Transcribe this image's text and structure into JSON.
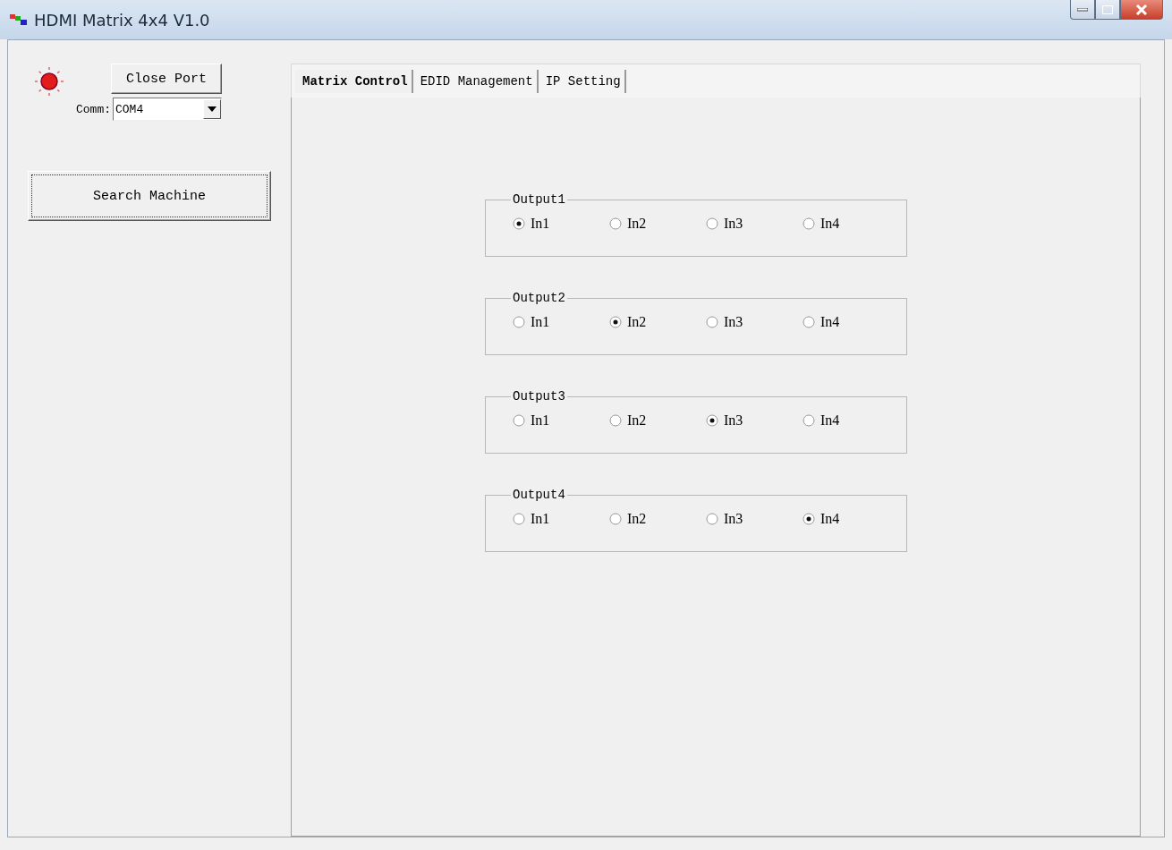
{
  "window": {
    "title": "HDMI Matrix 4x4 V1.0"
  },
  "port": {
    "connected": true,
    "button": "Close Port",
    "comm_label": "Comm:",
    "comm_value": "COM4"
  },
  "search_button": "Search Machine",
  "tabs": [
    {
      "label": "Matrix Control",
      "selected": true
    },
    {
      "label": "EDID Management",
      "selected": false
    },
    {
      "label": "IP Setting",
      "selected": false
    }
  ],
  "outputs": [
    {
      "title": "Output1",
      "inputs": [
        {
          "label": "In1",
          "selected": true
        },
        {
          "label": "In2",
          "selected": false
        },
        {
          "label": "In3",
          "selected": false
        },
        {
          "label": "In4",
          "selected": false
        }
      ]
    },
    {
      "title": "Output2",
      "inputs": [
        {
          "label": "In1",
          "selected": false
        },
        {
          "label": "In2",
          "selected": true
        },
        {
          "label": "In3",
          "selected": false
        },
        {
          "label": "In4",
          "selected": false
        }
      ]
    },
    {
      "title": "Output3",
      "inputs": [
        {
          "label": "In1",
          "selected": false
        },
        {
          "label": "In2",
          "selected": false
        },
        {
          "label": "In3",
          "selected": true
        },
        {
          "label": "In4",
          "selected": false
        }
      ]
    },
    {
      "title": "Output4",
      "inputs": [
        {
          "label": "In1",
          "selected": false
        },
        {
          "label": "In2",
          "selected": false
        },
        {
          "label": "In3",
          "selected": false
        },
        {
          "label": "In4",
          "selected": true
        }
      ]
    }
  ]
}
